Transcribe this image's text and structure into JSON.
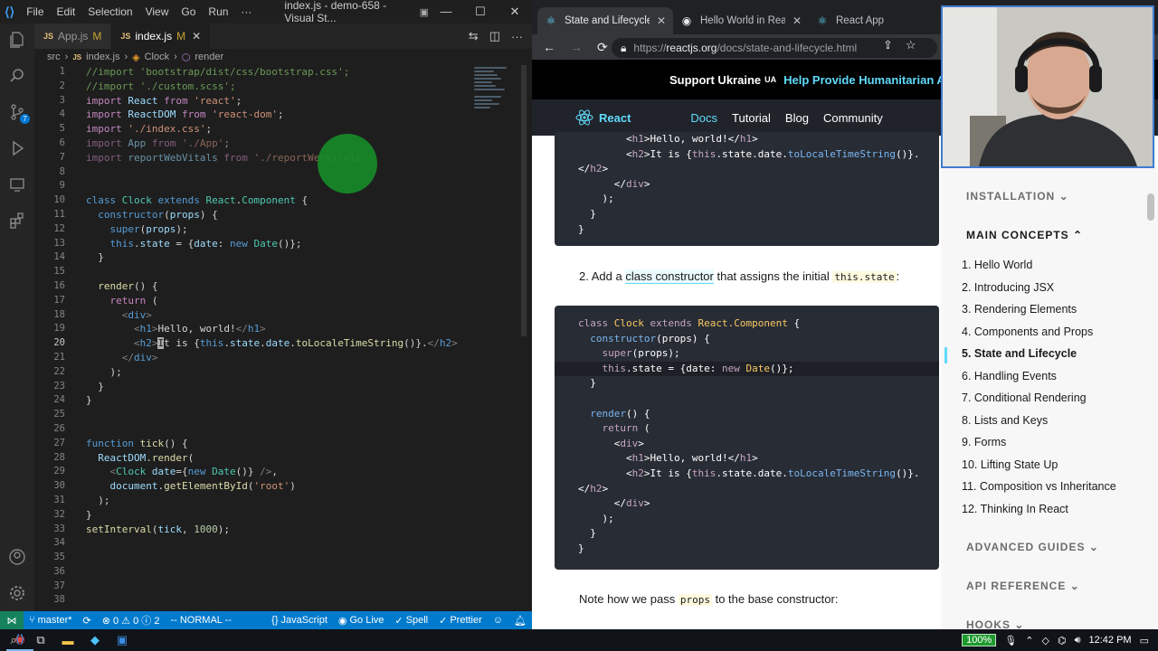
{
  "vscode": {
    "menu": [
      "File",
      "Edit",
      "Selection",
      "View",
      "Go",
      "Run",
      "···"
    ],
    "window_title": "index.js - demo-658 - Visual St...",
    "tabs": [
      {
        "label": "App.js",
        "modified": "M"
      },
      {
        "label": "index.js",
        "modified": "M"
      }
    ],
    "breadcrumb": [
      "src",
      "index.js",
      "Clock",
      "render"
    ],
    "line_numbers": [
      "1",
      "2",
      "3",
      "4",
      "5",
      "6",
      "7",
      "8",
      "9",
      "10",
      "11",
      "12",
      "13",
      "14",
      "15",
      "16",
      "17",
      "18",
      "19",
      "20",
      "21",
      "22",
      "23",
      "24",
      "25",
      "26",
      "27",
      "28",
      "29",
      "30",
      "31",
      "32",
      "33",
      "34",
      "35",
      "36",
      "37",
      "38"
    ],
    "current_line": "20",
    "status": {
      "branch": "master*",
      "problems": "⊗ 0 ⚠ 0 ⓘ 2",
      "mode": "-- NORMAL --",
      "language": "JavaScript",
      "golive": "Go Live",
      "spell": "Spell",
      "prettier": "Prettier"
    }
  },
  "browser": {
    "tabs": [
      {
        "label": "State and Lifecycle – R..."
      },
      {
        "label": "Hello World in React"
      },
      {
        "label": "React App"
      }
    ],
    "url_prefix": "https://",
    "url_host": "reactjs.org",
    "url_path": "/docs/state-and-lifecycle.html",
    "banner_text": "Support Ukraine",
    "banner_flag": "UA",
    "banner_link": "Help Provide Humanitarian Ai",
    "nav": {
      "logo": "React",
      "links": [
        "Docs",
        "Tutorial",
        "Blog",
        "Community"
      ]
    },
    "step2_prefix": "2. Add a ",
    "step2_link": "class constructor",
    "step2_mid": " that assigns the initial ",
    "step2_code": "this.state",
    "step2_suffix": ":",
    "note_prefix": "Note how we pass ",
    "note_code": "props",
    "note_suffix": " to the base constructor:",
    "sidebar": {
      "installation": "INSTALLATION",
      "main_concepts": "MAIN CONCEPTS",
      "items": [
        "1. Hello World",
        "2. Introducing JSX",
        "3. Rendering Elements",
        "4. Components and Props",
        "5. State and Lifecycle",
        "6. Handling Events",
        "7. Conditional Rendering",
        "8. Lists and Keys",
        "9. Forms",
        "10. Lifting State Up",
        "11. Composition vs Inheritance",
        "12. Thinking In React"
      ],
      "active_index": 4,
      "advanced": "ADVANCED GUIDES",
      "api": "API REFERENCE",
      "hooks": "HOOKS"
    }
  },
  "taskbar": {
    "zoom": "100%",
    "time": "12:42 PM"
  }
}
